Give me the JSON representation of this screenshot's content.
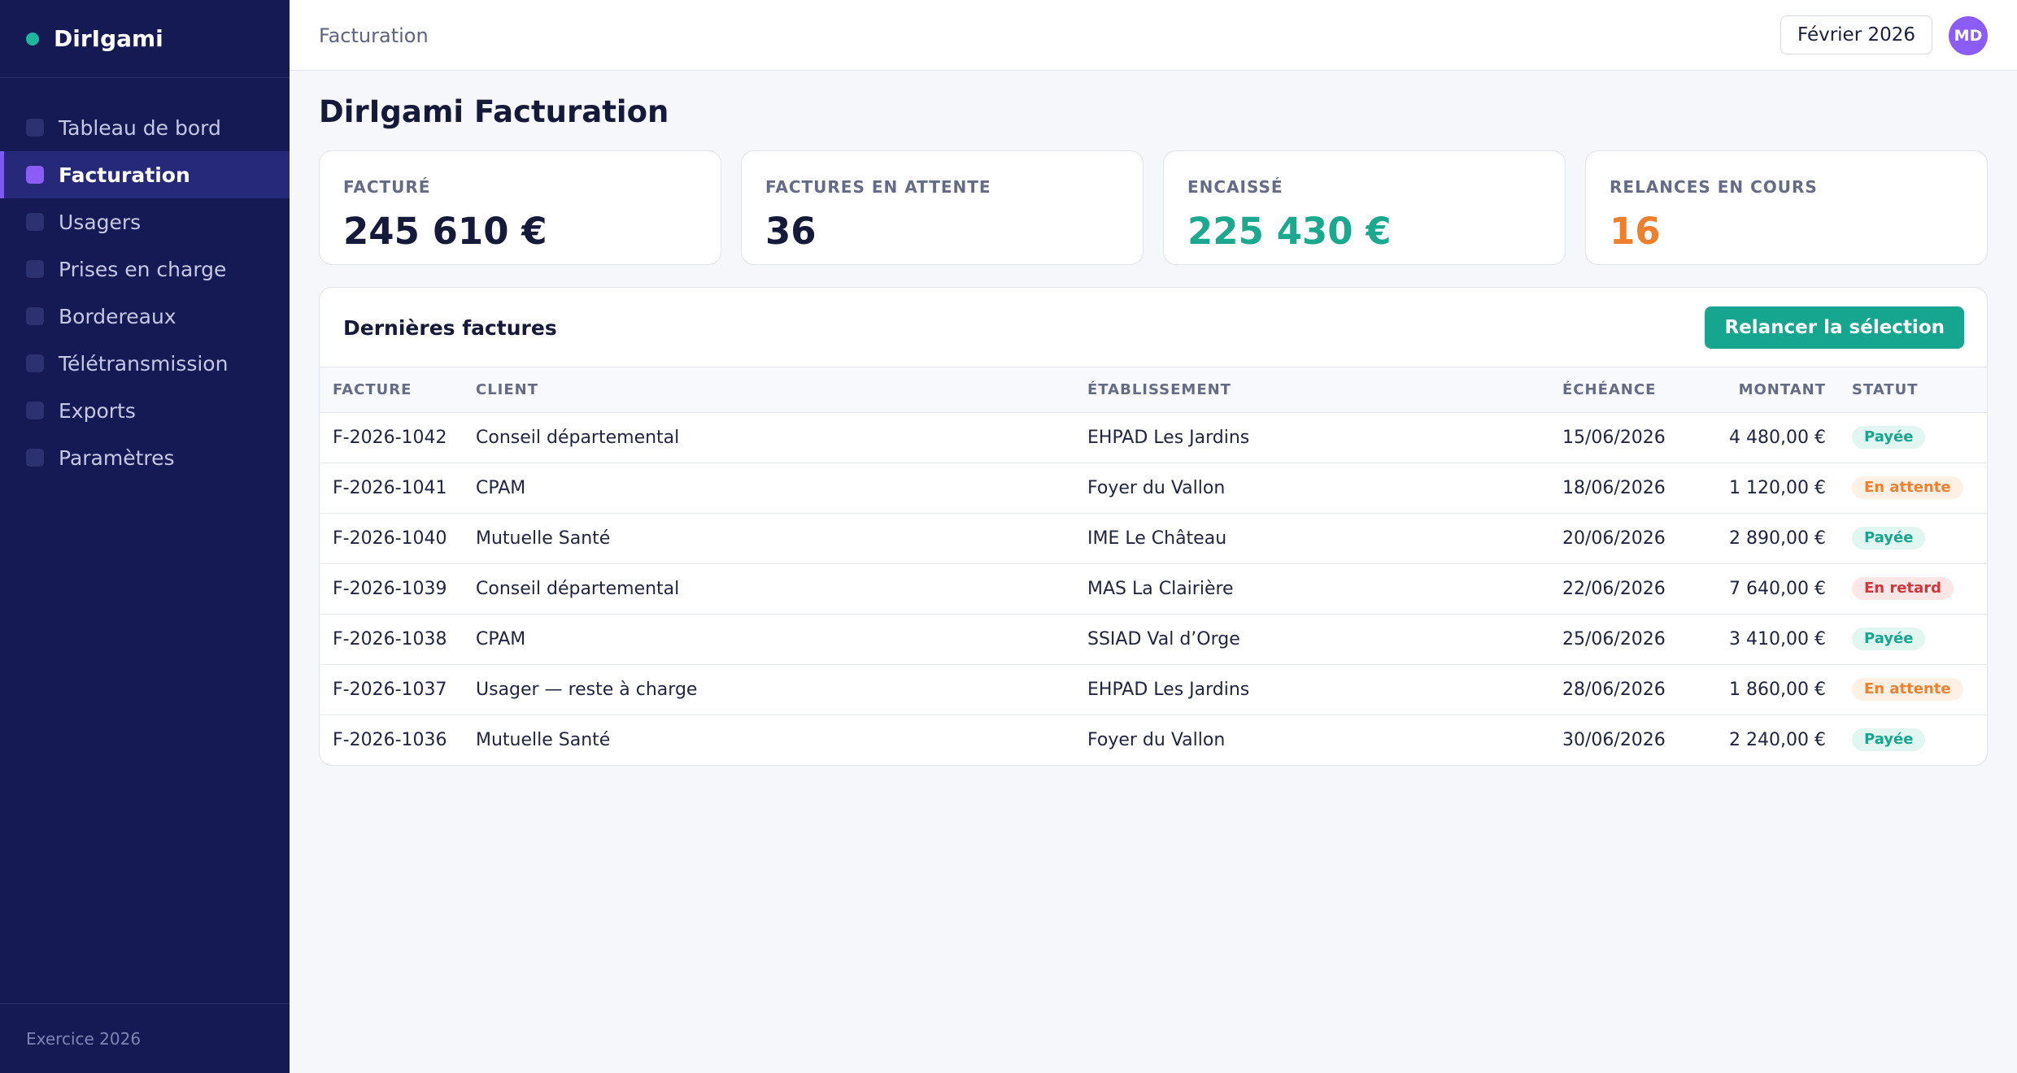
{
  "sidebar": {
    "brand": "DirIgami",
    "items": [
      {
        "label": "Tableau de bord"
      },
      {
        "label": "Facturation"
      },
      {
        "label": "Usagers"
      },
      {
        "label": "Prises en charge"
      },
      {
        "label": "Bordereaux"
      },
      {
        "label": "Télétransmission"
      },
      {
        "label": "Exports"
      },
      {
        "label": "Paramètres"
      }
    ],
    "active_item": "Facturation",
    "footer": "Exercice 2026"
  },
  "topbar": {
    "breadcrumb": "Facturation",
    "period": "Février 2026",
    "avatar_initials": "MD"
  },
  "page": {
    "title": "DirIgami Facturation"
  },
  "kpis": [
    {
      "label": "FACTURÉ",
      "value": "245 610 €"
    },
    {
      "label": "FACTURES EN ATTENTE",
      "value": "36"
    },
    {
      "label": "ENCAISSÉ",
      "value": "225 430 €"
    },
    {
      "label": "RELANCES EN COURS",
      "value": "16"
    }
  ],
  "invoices": {
    "title": "Dernières factures",
    "action_label": "Relancer la sélection",
    "columns": [
      "FACTURE",
      "CLIENT",
      "ÉTABLISSEMENT",
      "ÉCHÉANCE",
      "MONTANT",
      "STATUT"
    ],
    "rows": [
      {
        "invoice": "F-2026-1042",
        "client": "Conseil départemental",
        "establishment": "EHPAD Les Jardins",
        "due": "15/06/2026",
        "amount": "4 480,00 €",
        "status": "Payée"
      },
      {
        "invoice": "F-2026-1041",
        "client": "CPAM",
        "establishment": "Foyer du Vallon",
        "due": "18/06/2026",
        "amount": "1 120,00 €",
        "status": "En attente"
      },
      {
        "invoice": "F-2026-1040",
        "client": "Mutuelle Santé",
        "establishment": "IME Le Château",
        "due": "20/06/2026",
        "amount": "2 890,00 €",
        "status": "Payée"
      },
      {
        "invoice": "F-2026-1039",
        "client": "Conseil départemental",
        "establishment": "MAS La Clairière",
        "due": "22/06/2026",
        "amount": "7 640,00 €",
        "status": "En retard"
      },
      {
        "invoice": "F-2026-1038",
        "client": "CPAM",
        "establishment": "SSIAD Val d’Orge",
        "due": "25/06/2026",
        "amount": "3 410,00 €",
        "status": "Payée"
      },
      {
        "invoice": "F-2026-1037",
        "client": "Usager — reste à charge",
        "establishment": "EHPAD Les Jardins",
        "due": "28/06/2026",
        "amount": "1 860,00 €",
        "status": "En attente"
      },
      {
        "invoice": "F-2026-1036",
        "client": "Mutuelle Santé",
        "establishment": "Foyer du Vallon",
        "due": "30/06/2026",
        "amount": "2 240,00 €",
        "status": "Payée"
      }
    ]
  },
  "colors": {
    "sidebar_bg": "#161a54",
    "accent_purple": "#8b5cf6",
    "accent_teal": "#16a68f",
    "accent_orange": "#ef7f2d",
    "status_paid": "#16a68f",
    "status_pending": "#ec8131",
    "status_late": "#d1373a"
  }
}
